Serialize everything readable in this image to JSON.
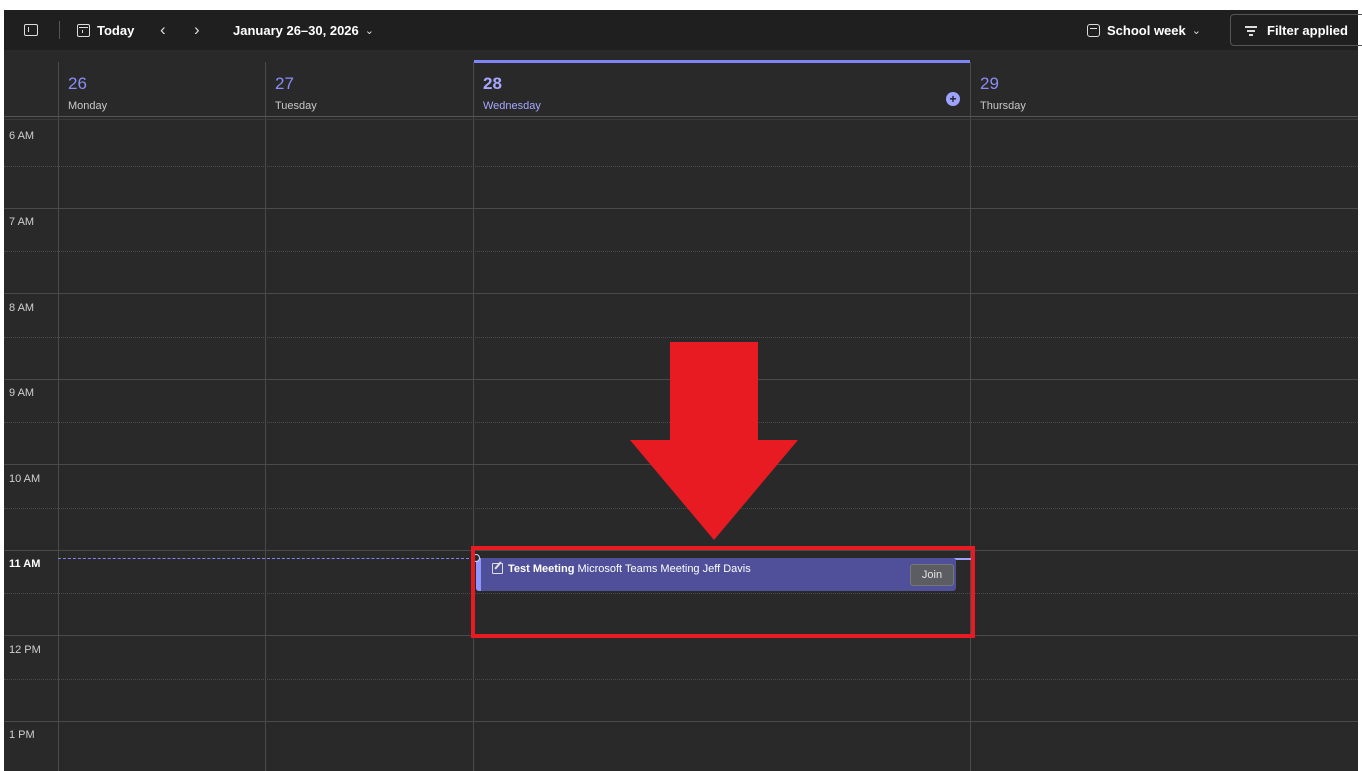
{
  "toolbar": {
    "today_label": "Today",
    "prev_symbol": "‹",
    "next_symbol": "›",
    "date_range": "January 26–30, 2026",
    "dropdown_symbol": "⌄",
    "view_label": "School week",
    "filter_label": "Filter applied",
    "icons": [
      "sidebar-toggle-icon",
      "calendar-today-icon",
      "chevron-left-icon",
      "chevron-right-icon",
      "chevron-down-icon",
      "calendar-week-icon",
      "filter-icon"
    ]
  },
  "days": [
    {
      "number": "26",
      "name": "Monday",
      "today": false
    },
    {
      "number": "27",
      "name": "Tuesday",
      "today": false
    },
    {
      "number": "28",
      "name": "Wednesday",
      "today": true
    },
    {
      "number": "29",
      "name": "Thursday",
      "today": false
    }
  ],
  "hours": [
    "6 AM",
    "7 AM",
    "8 AM",
    "9 AM",
    "10 AM",
    "11 AM",
    "12 PM",
    "1 PM"
  ],
  "event": {
    "title": "Test Meeting",
    "location": "Microsoft Teams Meeting",
    "organizer": "Jeff Davis",
    "join_label": "Join"
  },
  "add_event_symbol": "+",
  "colors": {
    "accent": "#7f85f5",
    "event_bg": "#4f4f9a",
    "background": "#292929",
    "annotation_red": "#e81b23"
  }
}
